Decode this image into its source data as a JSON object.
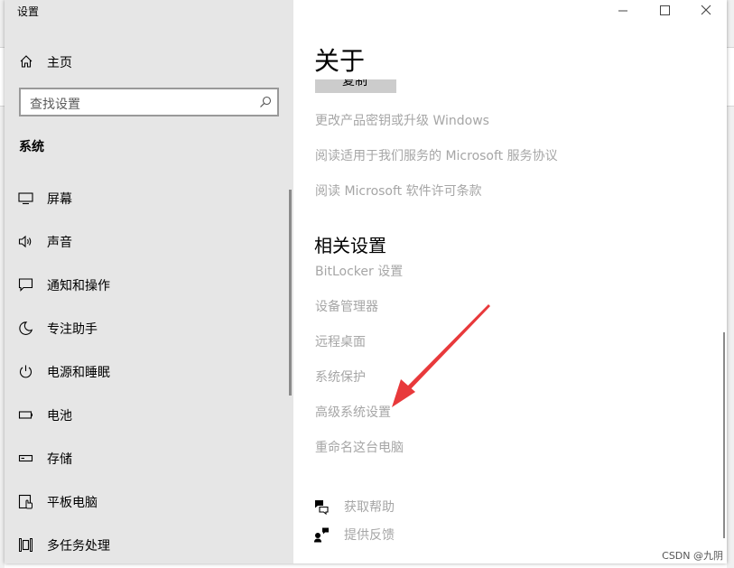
{
  "window": {
    "title": "设置"
  },
  "sidebar": {
    "home_label": "主页",
    "search_placeholder": "查找设置",
    "section_label": "系统",
    "items": [
      {
        "label": "屏幕",
        "icon": "display-icon"
      },
      {
        "label": "声音",
        "icon": "speaker-icon"
      },
      {
        "label": "通知和操作",
        "icon": "notification-icon"
      },
      {
        "label": "专注助手",
        "icon": "moon-icon"
      },
      {
        "label": "电源和睡眠",
        "icon": "power-icon"
      },
      {
        "label": "电池",
        "icon": "battery-icon"
      },
      {
        "label": "存储",
        "icon": "storage-icon"
      },
      {
        "label": "平板电脑",
        "icon": "tablet-icon"
      },
      {
        "label": "多任务处理",
        "icon": "multitask-icon"
      }
    ]
  },
  "content": {
    "page_title": "关于",
    "clipped_button_label": "复制",
    "links_top": [
      "更改产品密钥或升级 Windows",
      "阅读适用于我们服务的 Microsoft 服务协议",
      "阅读 Microsoft 软件许可条款"
    ],
    "related_title": "相关设置",
    "related_links": [
      "BitLocker 设置",
      "设备管理器",
      "远程桌面",
      "系统保护",
      "高级系统设置",
      "重命名这台电脑"
    ],
    "help_links": [
      {
        "label": "获取帮助",
        "icon": "help-chat-icon"
      },
      {
        "label": "提供反馈",
        "icon": "feedback-icon"
      }
    ]
  },
  "annotation": {
    "arrow_color": "#e8393b",
    "points_to": "高级系统设置"
  },
  "watermark": "CSDN @九阴",
  "colors": {
    "sidebar_bg": "#e6e6e6",
    "link_gray": "#a6a6a6",
    "content_bg": "#ffffff"
  }
}
